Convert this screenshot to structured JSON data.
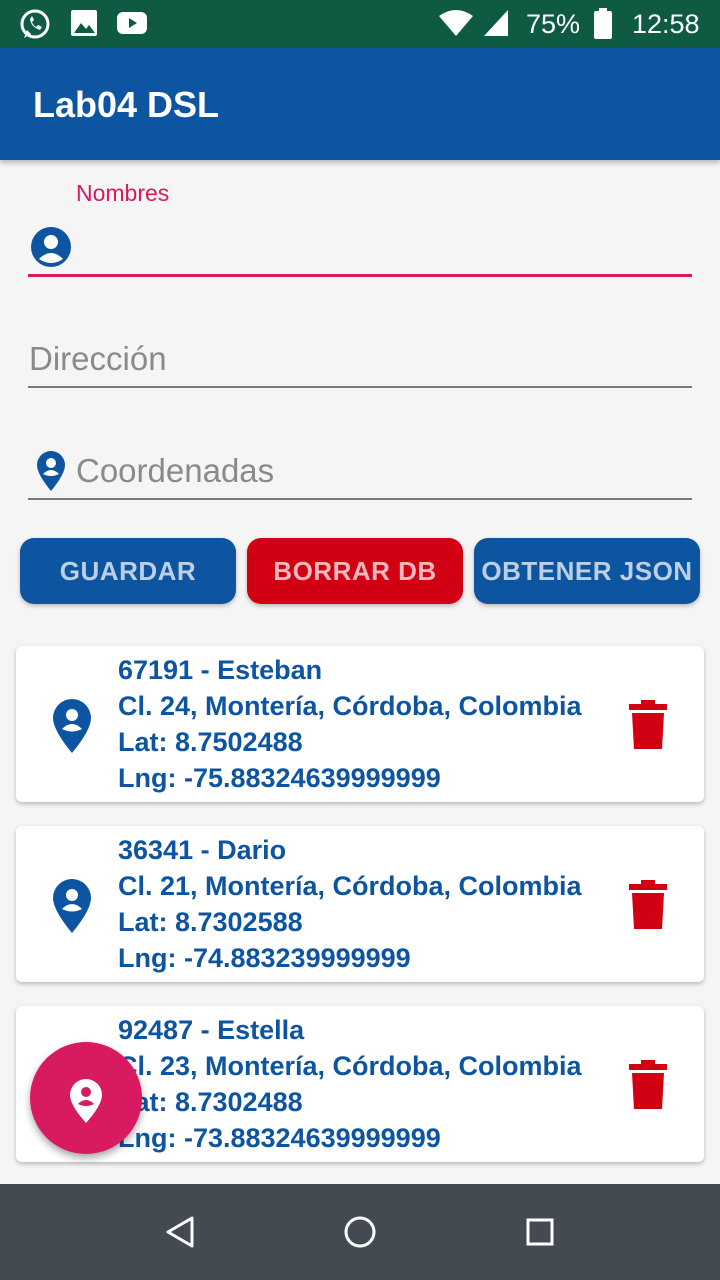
{
  "status_bar": {
    "battery": "75%",
    "time": "12:58",
    "left_icons": [
      "whatsapp-icon",
      "image-icon",
      "youtube-icon"
    ],
    "right_icons": [
      "wifi-icon",
      "signal-icon",
      "battery-icon"
    ]
  },
  "app_bar": {
    "title": "Lab04 DSL"
  },
  "form": {
    "nombres": {
      "label": "Nombres",
      "value": ""
    },
    "direccion": {
      "placeholder": "Dirección"
    },
    "coordenadas": {
      "placeholder": "Coordenadas"
    }
  },
  "buttons": {
    "guardar": "GUARDAR",
    "borrar": "BORRAR DB",
    "obtener": "OBTENER JSON"
  },
  "records": [
    {
      "title": "67191 - Esteban",
      "address": "Cl. 24, Montería, Córdoba, Colombia",
      "lat": "Lat: 8.7502488",
      "lng": "Lng: -75.88324639999999"
    },
    {
      "title": "36341 - Dario",
      "address": "Cl. 21, Montería, Córdoba, Colombia",
      "lat": "Lat: 8.7302588",
      "lng": "Lng: -74.883239999999"
    },
    {
      "title": "92487 - Estella",
      "address": "Cl. 23, Montería, Córdoba, Colombia",
      "lat": "Lat: 8.7302488",
      "lng": "Lng: -73.88324639999999"
    }
  ],
  "colors": {
    "primary": "#0e55a1",
    "accent": "#d81b60",
    "danger": "#d10012",
    "status_bar": "#0f5a42"
  }
}
